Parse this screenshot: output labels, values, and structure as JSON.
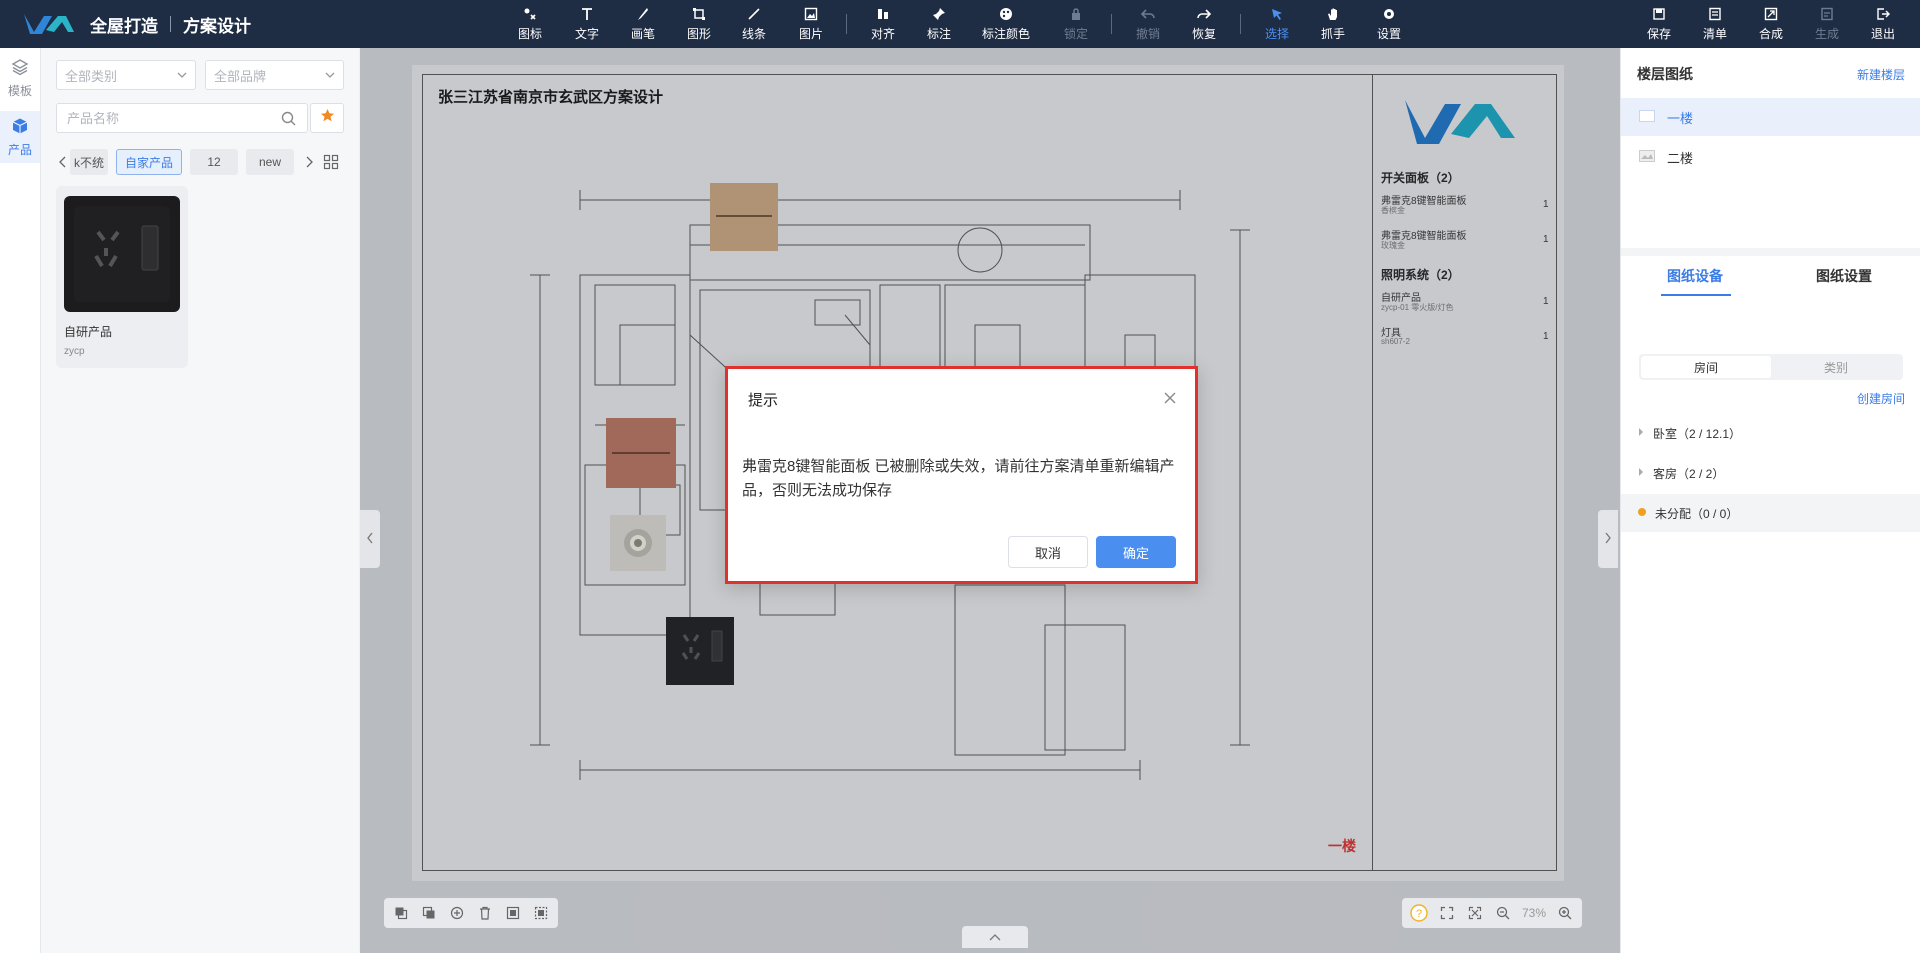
{
  "header": {
    "app_name": "全屋打造",
    "section_title": "方案设计",
    "tools": [
      {
        "label": "图标",
        "icon": "icons-icon"
      },
      {
        "label": "文字",
        "icon": "text-icon"
      },
      {
        "label": "画笔",
        "icon": "brush-icon"
      },
      {
        "label": "图形",
        "icon": "shape-icon"
      },
      {
        "label": "线条",
        "icon": "line-icon"
      },
      {
        "label": "图片",
        "icon": "image-icon"
      },
      {
        "label": "对齐",
        "icon": "align-icon"
      },
      {
        "label": "标注",
        "icon": "pin-icon"
      },
      {
        "label": "标注颜色",
        "icon": "palette-icon"
      },
      {
        "label": "锁定",
        "icon": "lock-icon"
      },
      {
        "label": "撤销",
        "icon": "undo-icon"
      },
      {
        "label": "恢复",
        "icon": "redo-icon"
      },
      {
        "label": "选择",
        "icon": "pointer-icon"
      },
      {
        "label": "抓手",
        "icon": "hand-icon"
      },
      {
        "label": "设置",
        "icon": "gear-icon"
      }
    ],
    "actions": [
      {
        "label": "保存",
        "icon": "save-icon"
      },
      {
        "label": "清单",
        "icon": "list-icon"
      },
      {
        "label": "合成",
        "icon": "merge-icon"
      },
      {
        "label": "生成",
        "icon": "generate-icon"
      },
      {
        "label": "退出",
        "icon": "exit-icon"
      }
    ]
  },
  "rail": {
    "items": [
      {
        "label": "模板",
        "icon": "layers-icon"
      },
      {
        "label": "产品",
        "icon": "box-icon"
      }
    ]
  },
  "filters": {
    "category_placeholder": "全部类别",
    "brand_placeholder": "全部品牌",
    "search_placeholder": "产品名称",
    "chips": [
      "k不统",
      "自家产品",
      "12",
      "new"
    ]
  },
  "product_card": {
    "name": "自研产品",
    "code": "zycp"
  },
  "sheet": {
    "title": "张三江苏省南京市玄武区方案设计",
    "floor_label": "一楼",
    "legend": {
      "groups": [
        {
          "title": "开关面板（2）",
          "items": [
            {
              "name": "弗雷克8键智能面板",
              "sub": "香槟金",
              "qty": "1"
            },
            {
              "name": "弗雷克8键智能面板",
              "sub": "玫瑰金",
              "qty": "1"
            }
          ]
        },
        {
          "title": "照明系统（2）",
          "items": [
            {
              "name": "自研产品",
              "sub": "zycp-01 零火版/灯色",
              "qty": "1"
            },
            {
              "name": "灯具",
              "sub": "sh607-2",
              "qty": "1"
            }
          ]
        }
      ]
    }
  },
  "zoom": {
    "level": "73%"
  },
  "right": {
    "floors_title": "楼层图纸",
    "new_floor": "新建楼层",
    "floors": [
      "一楼",
      "二楼"
    ],
    "tabs": [
      "图纸设备",
      "图纸设置"
    ],
    "segments": [
      "房间",
      "类别"
    ],
    "create_room": "创建房间",
    "rooms": [
      "卧室（2 / 12.1）",
      "客房（2 / 2）",
      "未分配（0 / 0）"
    ]
  },
  "dialog": {
    "title": "提示",
    "message": "弗雷克8键智能面板 已被删除或失效，请前往方案清单重新编辑产品，否则无法成功保存",
    "cancel": "取消",
    "confirm": "确定"
  },
  "colors": {
    "accent": "#4a8ff0",
    "topbar": "#1f2d44",
    "alert_border": "#e0312c",
    "logo": "#1a73c8"
  }
}
